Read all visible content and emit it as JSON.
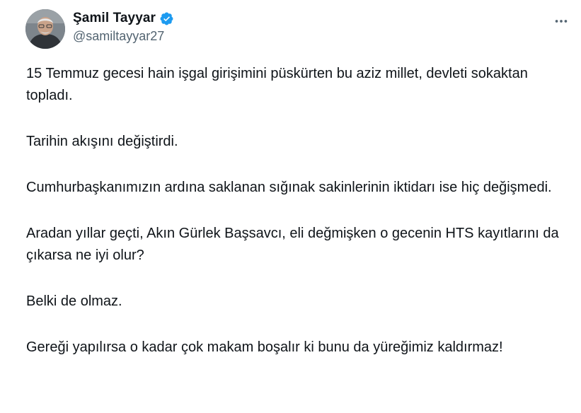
{
  "author": {
    "display_name": "Şamil Tayyar",
    "handle": "@samiltayyar27",
    "verified": true,
    "verified_icon": "verified-badge-icon",
    "avatar_icon": "profile-photo"
  },
  "actions": {
    "more_icon": "more-horizontal-icon"
  },
  "tweet": {
    "paragraphs": [
      "15 Temmuz gecesi hain işgal girişimini püskürten bu aziz millet, devleti sokaktan topladı.",
      "Tarihin akışını değiştirdi.",
      "Cumhurbaşkanımızın ardına saklanan sığınak sakinlerinin iktidarı ise hiç değişmedi.",
      "Aradan yıllar geçti, Akın Gürlek Başsavcı, eli değmişken o gecenin HTS kayıtlarını da çıkarsa ne iyi olur?",
      "Belki de olmaz.",
      "Gereği yapılırsa o kadar çok makam boşalır ki bunu da yüreğimiz kaldırmaz!"
    ]
  },
  "colors": {
    "text": "#0f1419",
    "secondary": "#536471",
    "verified": "#1d9bf0"
  }
}
